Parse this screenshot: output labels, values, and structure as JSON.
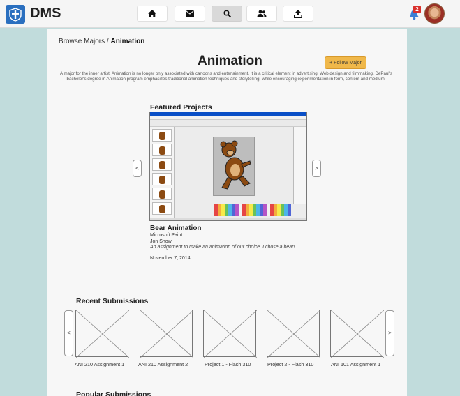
{
  "app": {
    "brand": "DMS"
  },
  "nav": {
    "icons": [
      "home-icon",
      "envelope-icon",
      "search-icon",
      "users-icon",
      "upload-icon"
    ],
    "active": "search-icon",
    "notification_count": "2"
  },
  "breadcrumb": {
    "parent": "Browse Majors",
    "separator": " / ",
    "current": "Animation"
  },
  "major": {
    "title": "Animation",
    "follow_label": "+ Follow Major",
    "description": "A major for the inner artist. Animation is no longer only associated with cartoons and entertainment. It is a critical element in advertising, Web design and filmmaking. DePaul's bachelor's degree in Animation program emphasizes traditional animation techniques and storytelling, while encouraging experimentation in form, content and medium."
  },
  "featured": {
    "heading": "Featured Projects",
    "prev": "<",
    "next": ">",
    "project": {
      "title": "Bear Animation",
      "tool": "Microsoft Paint",
      "author": "Jon Snow",
      "caption": "An assignment to make an animation of our choice. I chose a bear!",
      "date": "November 7, 2014"
    }
  },
  "recent": {
    "heading": "Recent Submissions",
    "prev": "<",
    "next": ">",
    "items": [
      {
        "label": "ANI 210 Assignment 1"
      },
      {
        "label": "ANI 210 Assignment 2"
      },
      {
        "label": "Project 1 - Flash 310"
      },
      {
        "label": "Project 2 - Flash 310"
      },
      {
        "label": "ANI 101 Assignment 1"
      }
    ]
  },
  "popular": {
    "heading": "Popular Submissions"
  },
  "colors": {
    "accent": "#f0b84a",
    "background": "#c1dcdc",
    "logo": "#2a6fbf",
    "badge": "#d9302c"
  }
}
